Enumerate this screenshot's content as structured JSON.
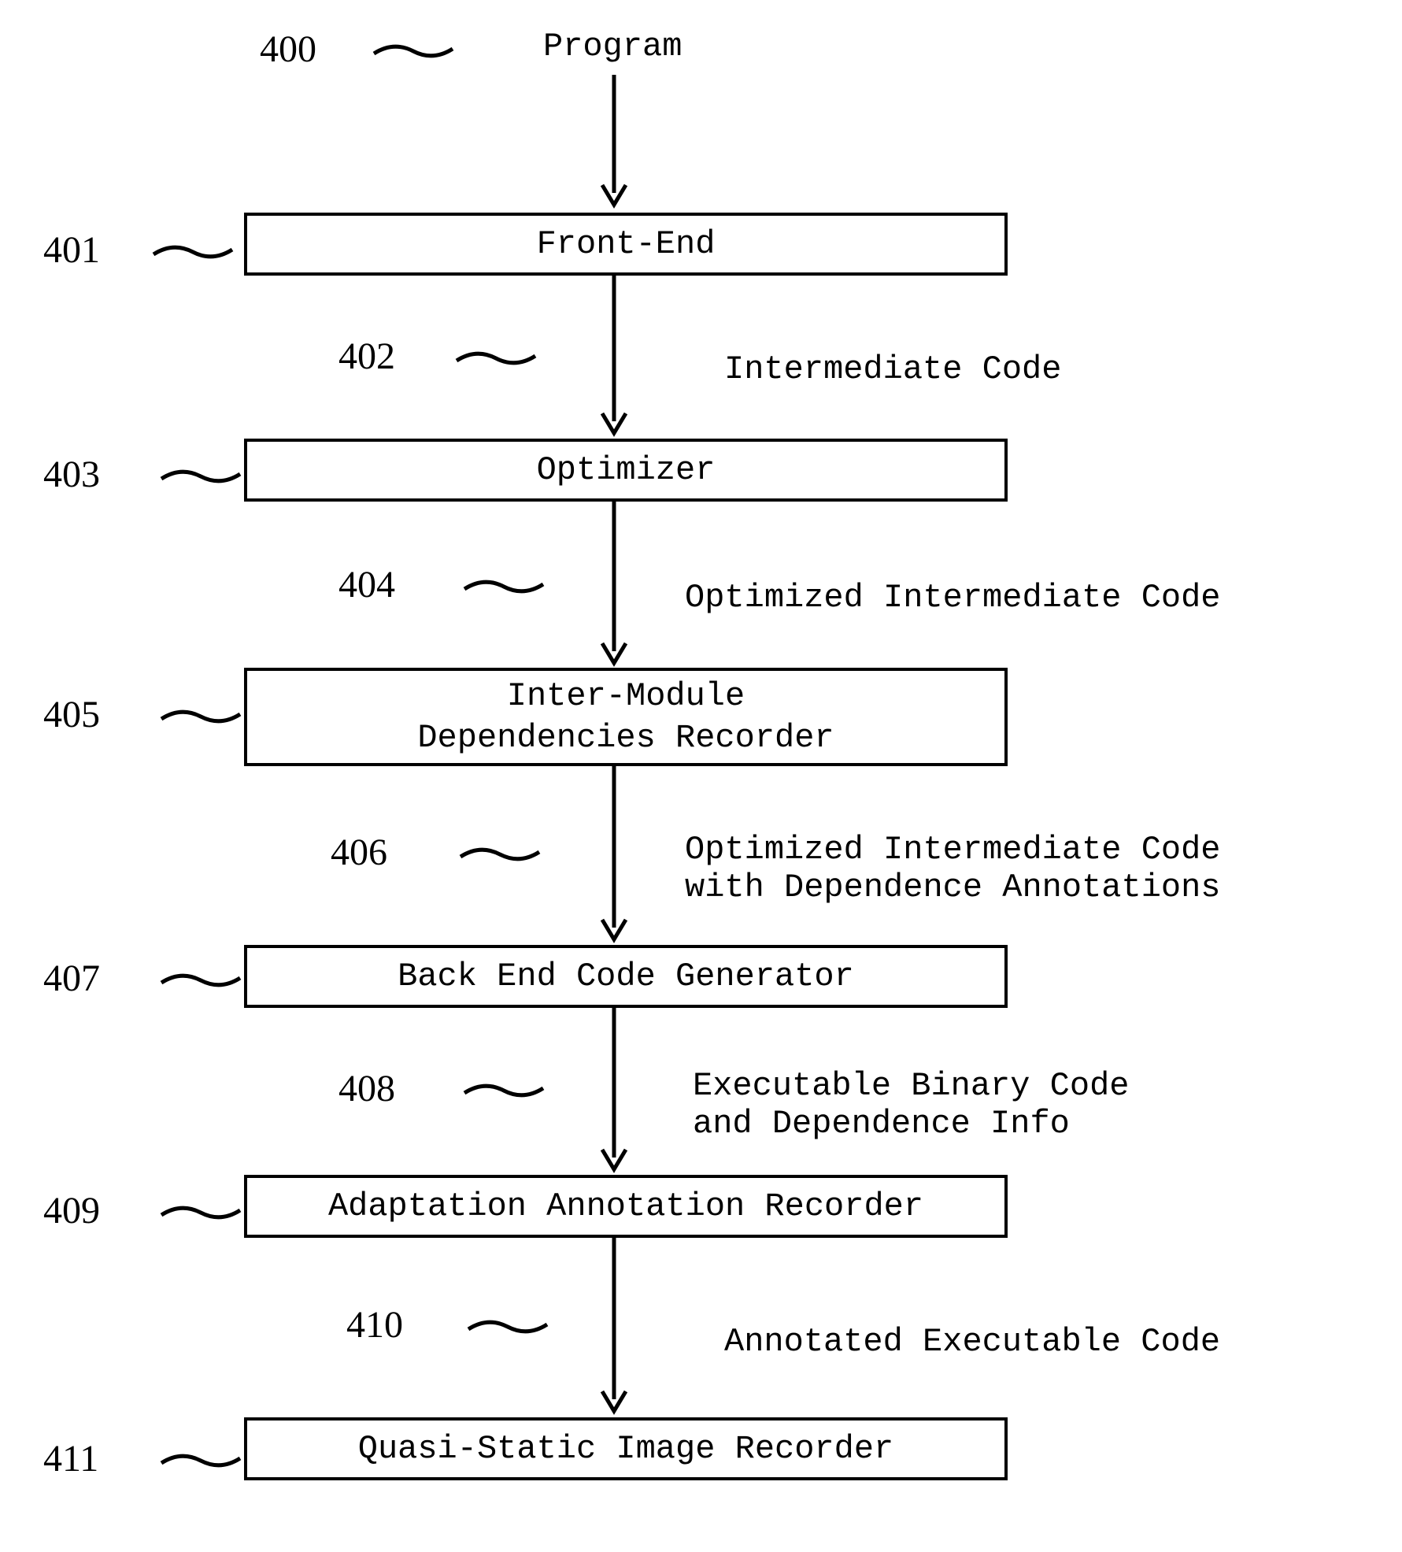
{
  "refs": {
    "r400": "400",
    "r401": "401",
    "r402": "402",
    "r403": "403",
    "r404": "404",
    "r405": "405",
    "r406": "406",
    "r407": "407",
    "r408": "408",
    "r409": "409",
    "r410": "410",
    "r411": "411"
  },
  "nodes": {
    "program": "Program",
    "frontend": "Front-End",
    "intermediate": "Intermediate Code",
    "optimizer": "Optimizer",
    "optimized": "Optimized Intermediate Code",
    "intermodule": "Inter-Module\nDependencies Recorder",
    "optimized_dep": "Optimized Intermediate Code\nwith Dependence Annotations",
    "backend": "Back End Code Generator",
    "exec_dep": "Executable Binary Code\nand Dependence Info",
    "adaptation": "Adaptation Annotation Recorder",
    "annotated": "Annotated Executable Code",
    "quasi": "Quasi-Static Image Recorder"
  }
}
